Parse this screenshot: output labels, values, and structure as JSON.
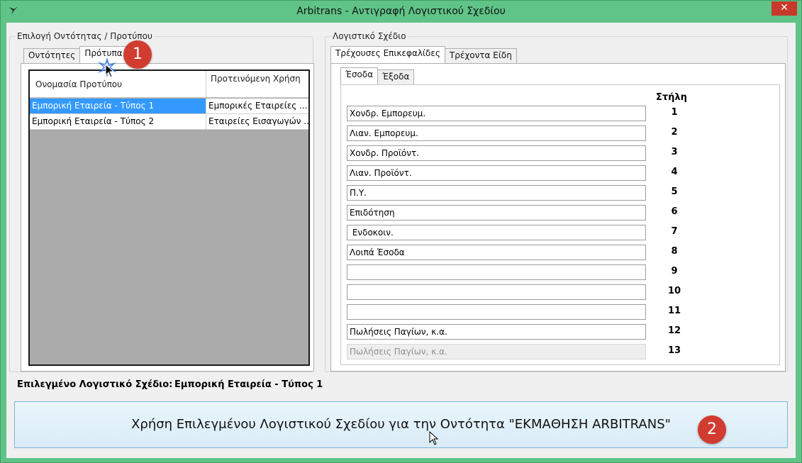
{
  "window": {
    "title": "Arbitrans - Αντιγραφή Λογιστικού Σχεδίου",
    "close_glyph": "✕",
    "app_icon": "bird-icon"
  },
  "left_group": {
    "legend": "Επιλογή Οντότητας / Προτύπου",
    "tabs": [
      {
        "label": "Οντότητες",
        "active": false
      },
      {
        "label": "Πρότυπα",
        "active": true
      }
    ],
    "grid": {
      "columns": [
        "Ονομασία Προτύπου",
        "Προτεινόμενη Χρήση"
      ],
      "rows": [
        {
          "name": "Εμπορική Εταιρεία - Τύπος 1",
          "use": "Εμπορικές Εταιρείες ...",
          "selected": true
        },
        {
          "name": "Εμπορική Εταιρεία - Τύπος 2",
          "use": "Εταιρείες Εισαγωγών ...",
          "selected": false
        }
      ]
    }
  },
  "right_group": {
    "legend": "Λογιστικό Σχέδιο",
    "tabs": [
      {
        "label": "Τρέχουσες Επικεφαλίδες",
        "active": true
      },
      {
        "label": "Τρέχοντα Είδη",
        "active": false
      }
    ],
    "subtabs": [
      {
        "label": "Έσοδα",
        "active": true
      },
      {
        "label": "Έξοδα",
        "active": false
      }
    ],
    "column_header": "Στήλη",
    "fields": [
      {
        "value": "Χονδρ. Εμπορευμ.",
        "col": "1",
        "disabled": false
      },
      {
        "value": "Λιαν. Εμπορευμ.",
        "col": "2",
        "disabled": false
      },
      {
        "value": "Χονδρ. Προϊόντ.",
        "col": "3",
        "disabled": false
      },
      {
        "value": "Λιαν. Προϊόντ.",
        "col": "4",
        "disabled": false
      },
      {
        "value": "Π.Υ.",
        "col": "5",
        "disabled": false
      },
      {
        "value": "Επιδότηση",
        "col": "6",
        "disabled": false
      },
      {
        "value": " Ενδοκοιν.",
        "col": "7",
        "disabled": false
      },
      {
        "value": "Λοιπά Έσοδα",
        "col": "8",
        "disabled": false
      },
      {
        "value": "",
        "col": "9",
        "disabled": false
      },
      {
        "value": "",
        "col": "10",
        "disabled": false
      },
      {
        "value": "",
        "col": "11",
        "disabled": false
      },
      {
        "value": "Πωλήσεις Παγίων, κ.α.",
        "col": "12",
        "disabled": false
      },
      {
        "value": "Πωλήσεις Παγίων, κ.α.",
        "col": "13",
        "disabled": true
      }
    ]
  },
  "selected_plan": {
    "label": "Επιλεγμένο Λογιστικό Σχέδιο:",
    "value": "Εμπορική Εταιρεία - Τύπος 1"
  },
  "apply_button": {
    "label": "Χρήση Επιλεγμένου Λογιστικού Σχεδίου για την Οντότητα \"ΕΚΜΑΘΗΣΗ  ARBITRANS\""
  },
  "annotations": {
    "badge1": "1",
    "badge2": "2",
    "badge_color": "#d23b30"
  }
}
